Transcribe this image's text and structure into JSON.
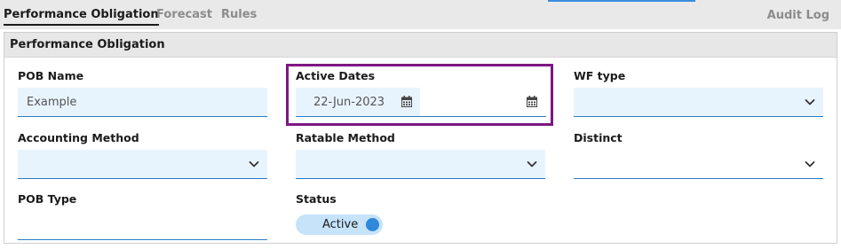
{
  "tabs": [
    {
      "label": "Performance Obligation",
      "active": true
    },
    {
      "label": "Forecast",
      "active": false
    },
    {
      "label": "Rules",
      "active": false
    }
  ],
  "audit_log_label": "Audit Log",
  "panel": {
    "title": "Performance Obligation"
  },
  "fields": {
    "pob_name": {
      "label": "POB Name",
      "value": "Example"
    },
    "active_dates": {
      "label": "Active Dates",
      "start_value": "22-Jun-2023",
      "end_value": ""
    },
    "wf_type": {
      "label": "WF type",
      "value": ""
    },
    "accounting_method": {
      "label": "Accounting Method",
      "value": ""
    },
    "ratable_method": {
      "label": "Ratable Method",
      "value": ""
    },
    "distinct": {
      "label": "Distinct",
      "value": ""
    },
    "pob_type": {
      "label": "POB Type",
      "value": ""
    },
    "status": {
      "label": "Status",
      "value": "Active",
      "on": true
    }
  },
  "icons": {
    "calendar": "calendar-icon",
    "dropdown": "chevron-down-icon"
  },
  "colors": {
    "accent": "#2b7bc4",
    "field_bg": "#e8f4fd",
    "highlight": "#7d1783",
    "toggle_bg": "#c6e3fa",
    "toggle_knob": "#2f88da"
  }
}
